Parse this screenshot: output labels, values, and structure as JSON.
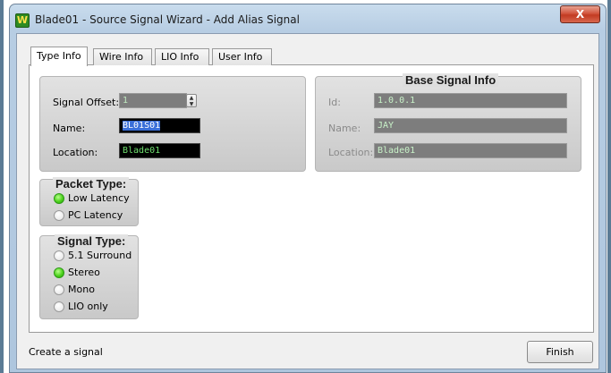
{
  "window": {
    "title": "Blade01 - Source Signal Wizard - Add Alias Signal",
    "app_icon_glyph": "W",
    "close_glyph": "X"
  },
  "tabs": [
    {
      "label": "Type Info",
      "active": true
    },
    {
      "label": "Wire Info",
      "active": false
    },
    {
      "label": "LIO Info",
      "active": false
    },
    {
      "label": "User Info",
      "active": false
    }
  ],
  "signal_group": {
    "offset_label": "Signal Offset:",
    "offset_value": "1",
    "name_label": "Name:",
    "name_value": "BL01S01",
    "location_label": "Location:",
    "location_value": "Blade01"
  },
  "base_signal_info": {
    "title": "Base Signal Info",
    "id_label": "Id:",
    "id_value": "1.0.0.1",
    "name_label": "Name:",
    "name_value": "JAY",
    "location_label": "Location:",
    "location_value": "Blade01"
  },
  "packet_type": {
    "title": "Packet Type:",
    "options": [
      {
        "label": "Low Latency",
        "selected": true
      },
      {
        "label": "PC Latency",
        "selected": false
      }
    ]
  },
  "signal_type": {
    "title": "Signal Type:",
    "options": [
      {
        "label": "5.1 Surround",
        "selected": false
      },
      {
        "label": "Stereo",
        "selected": true
      },
      {
        "label": "Mono",
        "selected": false
      },
      {
        "label": "LIO only",
        "selected": false
      }
    ]
  },
  "footer": {
    "status_text": "Create a signal",
    "finish_label": "Finish"
  },
  "colors": {
    "field_text": "#6fe06f",
    "radio_selected": "#4dd21d",
    "close_button": "#c23a22"
  }
}
